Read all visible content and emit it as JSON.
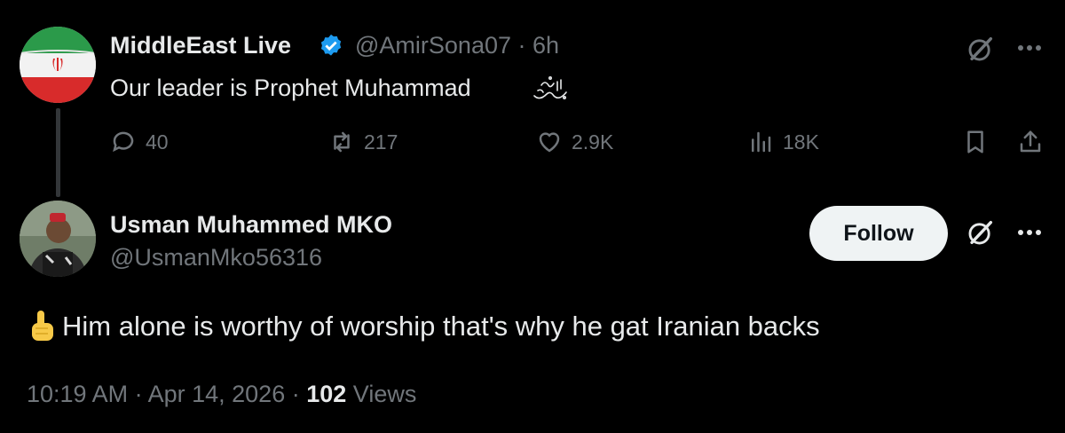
{
  "tweet": {
    "author_name": "MiddleEast Live",
    "author_handle": "@AmirSona07",
    "time_ago": "6h",
    "text": "Our leader is Prophet Muhammad",
    "stats": {
      "replies": "40",
      "retweets": "217",
      "likes": "2.9K",
      "views": "18K"
    }
  },
  "reply": {
    "author_name": "Usman Muhammed MKO",
    "author_handle": "@UsmanMko56316",
    "follow_label": "Follow",
    "text": "Him alone is worthy of worship that's why he gat Iranian backs",
    "time": "10:19 AM",
    "date": "Apr 14, 2026",
    "views_count": "102",
    "views_label": "Views"
  },
  "colors": {
    "background": "#000000",
    "primary_text": "#e7e9ea",
    "secondary_text": "#71767b",
    "verified_blue": "#1d9bf0",
    "follow_bg": "#eff3f4"
  }
}
